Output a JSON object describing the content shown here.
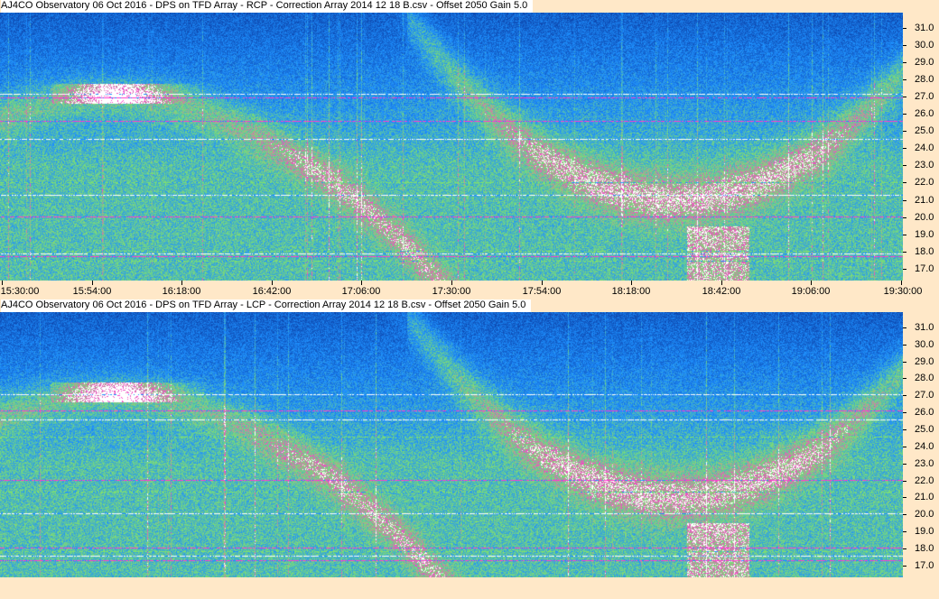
{
  "chart_data": [
    {
      "type": "heatmap",
      "title": "AJ4CO Observatory 06 Oct 2016 - DPS on TFD Array - RCP - Correction Array 2014 12 18 B.csv - Offset 2050  Gain 5.0",
      "y_tick_labels": [
        "31.0",
        "30.0",
        "29.0",
        "28.0",
        "27.0",
        "26.0",
        "25.0",
        "24.0",
        "23.0",
        "22.0",
        "21.0",
        "20.0",
        "19.0",
        "18.0",
        "17.0"
      ],
      "ylim": [
        16.3,
        31.9
      ],
      "x_tick_labels": [
        "15:30:00",
        "15:54:00",
        "16:18:00",
        "16:42:00",
        "17:06:00",
        "17:30:00",
        "17:54:00",
        "18:18:00",
        "18:42:00",
        "19:06:00",
        "19:30:00"
      ],
      "xlim": [
        "15:30:00",
        "19:30:00"
      ],
      "colors": {
        "low": "#0a3aa0",
        "mid": "#1e90ff",
        "high": "#7ee070",
        "peak": "#ff3ad0",
        "sat": "#ffffff"
      }
    },
    {
      "type": "heatmap",
      "title": "AJ4CO Observatory 06 Oct 2016 - DPS on TFD Array - LCP - Correction Array 2014 12 18 B.csv - Offset 2050  Gain 5.0",
      "y_tick_labels": [
        "31.0",
        "30.0",
        "29.0",
        "28.0",
        "27.0",
        "26.0",
        "25.0",
        "24.0",
        "23.0",
        "22.0",
        "21.0",
        "20.0",
        "19.0",
        "18.0",
        "17.0"
      ],
      "ylim": [
        16.3,
        31.9
      ],
      "colors": {
        "low": "#0a3aa0",
        "mid": "#1e90ff",
        "high": "#7ee070",
        "peak": "#ff3ad0",
        "sat": "#ffffff"
      }
    }
  ]
}
